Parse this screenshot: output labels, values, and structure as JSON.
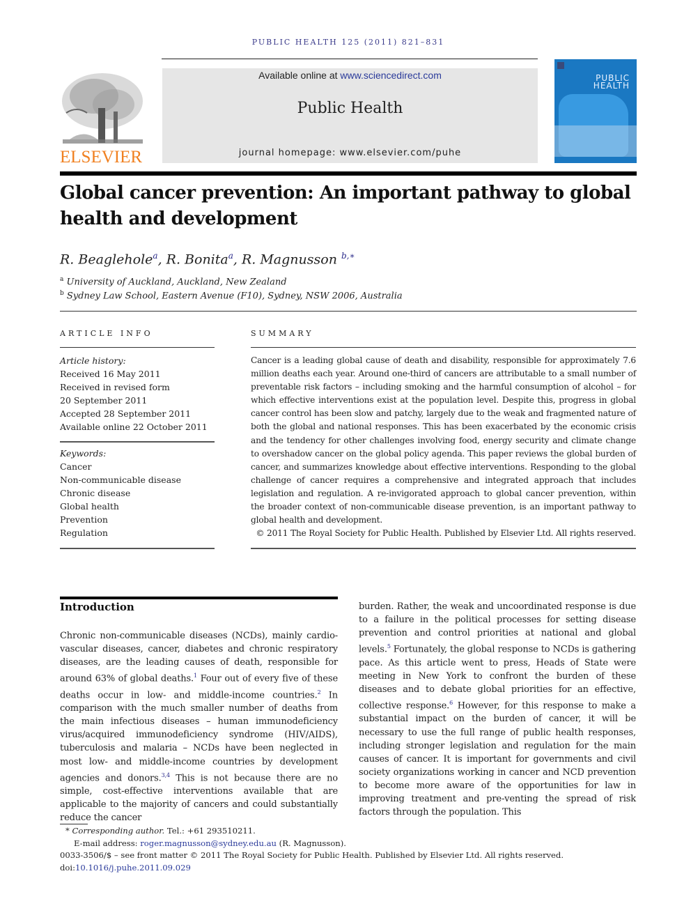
{
  "running_head": "PUBLIC HEALTH 125 (2011) 821–831",
  "publisher": {
    "logo_icon": "elsevier-tree-logo",
    "name": "ELSEVIER",
    "brand_color": "#f08020"
  },
  "banner": {
    "available_prefix": "Available online at ",
    "available_link": "www.sciencedirect.com",
    "journal_name": "Public Health",
    "homepage": "journal homepage: www.elsevier.com/puhe"
  },
  "cover": {
    "title_line1": "PUBLIC",
    "title_line2": "HEALTH",
    "color": "#1a78c2"
  },
  "article": {
    "title": "Global cancer prevention: An important pathway to global health and development",
    "authors": [
      {
        "name": "R. Beaglehole",
        "sup": "a"
      },
      {
        "name": "R. Bonita",
        "sup": "a"
      },
      {
        "name": "R. Magnusson",
        "sup": "b,∗"
      }
    ],
    "affiliations": [
      {
        "mark": "a",
        "text": "University of Auckland, Auckland, New Zealand"
      },
      {
        "mark": "b",
        "text": "Sydney Law School, Eastern Avenue (F10), Sydney, NSW 2006, Australia"
      }
    ]
  },
  "article_info": {
    "heading": "ARTICLE INFO",
    "history_label": "Article history:",
    "history": [
      "Received 16 May 2011",
      "Received in revised form",
      "20 September 2011",
      "Accepted 28 September 2011",
      "Available online 22 October 2011"
    ],
    "keywords_label": "Keywords:",
    "keywords": [
      "Cancer",
      "Non-communicable disease",
      "Chronic disease",
      "Global health",
      "Prevention",
      "Regulation"
    ]
  },
  "summary": {
    "heading": "SUMMARY",
    "text": "Cancer is a leading global cause of death and disability, responsible for approximately 7.6 million deaths each year. Around one-third of cancers are attributable to a small number of preventable risk factors – including smoking and the harmful consumption of alcohol – for which effective interventions exist at the population level. Despite this, progress in global cancer control has been slow and patchy, largely due to the weak and fragmented nature of both the global and national responses. This has been exacerbated by the economic crisis and the tendency for other challenges involving food, energy security and climate change to overshadow cancer on the global policy agenda. This paper reviews the global burden of cancer, and summarizes knowledge about effective interventions. Responding to the global challenge of cancer requires a comprehensive and integrated approach that includes legislation and regulation. A re-invigorated approach to global cancer prevention, within the broader context of non-communicable disease prevention, is an important pathway to global health and development.",
    "copyright": "© 2011 The Royal Society for Public Health. Published by Elsevier Ltd. All rights reserved."
  },
  "introduction": {
    "heading": "Introduction",
    "left": {
      "p1": "Chronic non-communicable diseases (NCDs), mainly cardio-vascular diseases, cancer, diabetes and chronic respiratory diseases, are the leading causes of death, responsible for around 63% of global deaths.",
      "ref1": "1",
      "p2": " Four out of every five of these deaths occur in low- and middle-income countries.",
      "ref2": "2",
      "p3": " In comparison with the much smaller number of deaths from the main infectious diseases – human immunodeficiency virus/acquired immunodeficiency syndrome (HIV/AIDS), tuberculosis and malaria – NCDs have been neglected in most low- and middle-income countries by development agencies and donors.",
      "ref3": "3,4",
      "p4": " This is not because there are no simple, cost-effective interventions available that are applicable to the majority of cancers and could substantially reduce the cancer"
    },
    "right": {
      "p1": "burden. Rather, the weak and uncoordinated response is due to a failure in the political processes for setting disease prevention and control priorities at national and global levels.",
      "ref1": "5",
      "p2": " Fortunately, the global response to NCDs is gathering pace. As this article went to press, Heads of State were meeting in New York to confront the burden of these diseases and to debate global priorities for an effective, collective response.",
      "ref2": "6",
      "p3": " However, for this response to make a substantial impact on the burden of cancer, it will be necessary to use the full range of public health responses, including stronger legislation and regulation for the main causes of cancer. It is important for governments and civil society organizations working in cancer and NCD prevention to become more aware of the opportunities for law in improving treatment and pre-venting the spread of risk factors through the population. This"
    }
  },
  "footnotes": {
    "corr_mark": "*",
    "corr_label": "Corresponding author.",
    "tel": " Tel.: +61 293510211.",
    "email_label": "E-mail address: ",
    "email": "roger.magnusson@sydney.edu.au",
    "email_suffix": " (R. Magnusson).",
    "front_matter": "0033-3506/$ – see front matter © 2011 The Royal Society for Public Health. Published by Elsevier Ltd. All rights reserved.",
    "doi_prefix": "doi:",
    "doi": "10.1016/j.puhe.2011.09.029"
  }
}
